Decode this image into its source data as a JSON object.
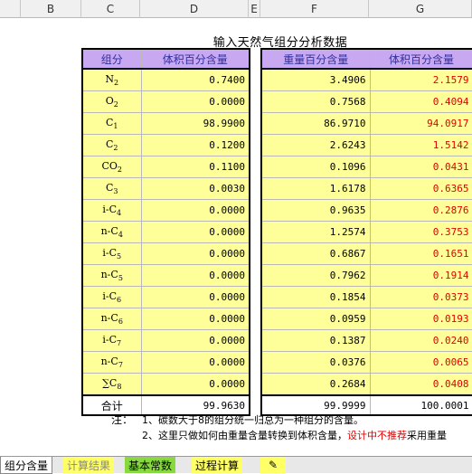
{
  "columns": [
    "B",
    "C",
    "D",
    "E",
    "F",
    "G"
  ],
  "title": "输入天然气组分分析数据",
  "left_headers": [
    "组分",
    "体积百分含量"
  ],
  "right_headers": [
    "重量百分含量",
    "体积百分含量"
  ],
  "rows": [
    {
      "base": "N",
      "sub": "2",
      "pre": "",
      "vol": "0.7400",
      "wt": "3.4906",
      "vol2": "2.1579"
    },
    {
      "base": "O",
      "sub": "2",
      "pre": "",
      "vol": "0.0000",
      "wt": "0.7568",
      "vol2": "0.4094"
    },
    {
      "base": "C",
      "sub": "1",
      "pre": "",
      "vol": "98.9900",
      "wt": "86.9710",
      "vol2": "94.0917"
    },
    {
      "base": "C",
      "sub": "2",
      "pre": "",
      "vol": "0.1200",
      "wt": "2.6243",
      "vol2": "1.5142"
    },
    {
      "base": "CO",
      "sub": "2",
      "pre": "",
      "vol": "0.1100",
      "wt": "0.1096",
      "vol2": "0.0431"
    },
    {
      "base": "C",
      "sub": "3",
      "pre": "",
      "vol": "0.0030",
      "wt": "1.6178",
      "vol2": "0.6365"
    },
    {
      "base": "C",
      "sub": "4",
      "pre": "i-",
      "vol": "0.0000",
      "wt": "0.9635",
      "vol2": "0.2876"
    },
    {
      "base": "C",
      "sub": "4",
      "pre": "n-",
      "vol": "0.0000",
      "wt": "1.2574",
      "vol2": "0.3753"
    },
    {
      "base": "C",
      "sub": "5",
      "pre": "i-",
      "vol": "0.0000",
      "wt": "0.6867",
      "vol2": "0.1651"
    },
    {
      "base": "C",
      "sub": "5",
      "pre": "n-",
      "vol": "0.0000",
      "wt": "0.7962",
      "vol2": "0.1914"
    },
    {
      "base": "C",
      "sub": "6",
      "pre": "i-",
      "vol": "0.0000",
      "wt": "0.1854",
      "vol2": "0.0373"
    },
    {
      "base": "C",
      "sub": "6",
      "pre": "n-",
      "vol": "0.0000",
      "wt": "0.0959",
      "vol2": "0.0193"
    },
    {
      "base": "C",
      "sub": "7",
      "pre": "i-",
      "vol": "0.0000",
      "wt": "0.1387",
      "vol2": "0.0240"
    },
    {
      "base": "C",
      "sub": "7",
      "pre": "n-",
      "vol": "0.0000",
      "wt": "0.0376",
      "vol2": "0.0065"
    },
    {
      "base": "C",
      "sub": "8",
      "pre": "∑",
      "vol": "0.0000",
      "wt": "0.2684",
      "vol2": "0.0408"
    }
  ],
  "total": {
    "label": "合计",
    "vol": "99.9630",
    "wt": "99.9999",
    "vol2": "100.0001"
  },
  "notes": {
    "label": "注：",
    "line1": "1、碳数大于8的组分统一归总为一种组分的含量。",
    "line2_a": "2、这里只做如何由重量含量转换到体积含量，",
    "line2_b": "设计中不推荐",
    "line2_c": "采用重量"
  },
  "sheet_tabs": [
    "组分含量",
    "计算结果",
    "基本常数",
    "过程计算"
  ],
  "colors": {
    "header_purple": "#c8a8f0",
    "cell_yellow": "#ffff99",
    "red": "#e00000"
  }
}
